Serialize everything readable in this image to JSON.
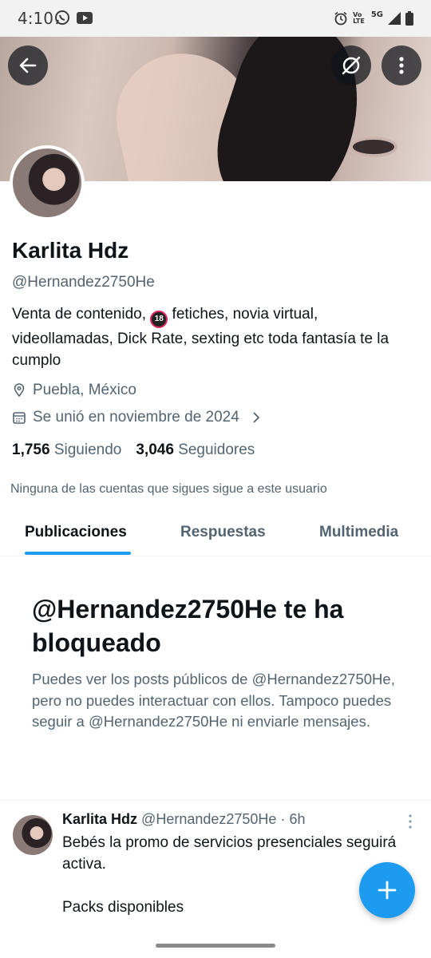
{
  "status_bar": {
    "time": "4:10",
    "network_label": "5G",
    "volte_line1": "Vo",
    "volte_line2": "LTE"
  },
  "icons": {
    "back": "arrow-left-icon",
    "translate": "translate-slash-icon",
    "more": "more-vertical-icon",
    "location": "location-pin-icon",
    "calendar": "calendar-icon",
    "compose": "plus-icon"
  },
  "profile": {
    "name": "Karlita Hdz",
    "handle": "@Hernandez2750He",
    "bio_before": "Venta de contenido, ",
    "bio_badge": "18",
    "bio_after": " fetiches, novia virtual, videollamadas, Dick Rate, sexting etc toda fantasía te la cumplo",
    "location": "Puebla, México",
    "joined": "Se unió en noviembre de 2024",
    "following_count": "1,756",
    "following_label": "Siguiendo",
    "followers_count": "3,046",
    "followers_label": "Seguidores",
    "mutual_note": "Ninguna de las cuentas que sigues sigue a este usuario"
  },
  "tabs": [
    {
      "label": "Publicaciones",
      "active": true
    },
    {
      "label": "Respuestas",
      "active": false
    },
    {
      "label": "Multimedia",
      "active": false
    }
  ],
  "blocked": {
    "title": "@Hernandez2750He te ha bloqueado",
    "description": "Puedes ver los posts públicos de @Hernandez2750He, pero no puedes interactuar con ellos. Tampoco puedes seguir a @Hernandez2750He ni enviarle mensajes."
  },
  "post": {
    "author_name": "Karlita Hdz",
    "author_handle": "@Hernandez2750He",
    "separator": " · ",
    "time": "6h",
    "text": "Bebés la promo de servicios presenciales seguirá activa.\n\nPacks disponibles"
  },
  "colors": {
    "accent": "#1d9bf0",
    "text_primary": "#0f1419",
    "text_secondary": "#536471"
  }
}
